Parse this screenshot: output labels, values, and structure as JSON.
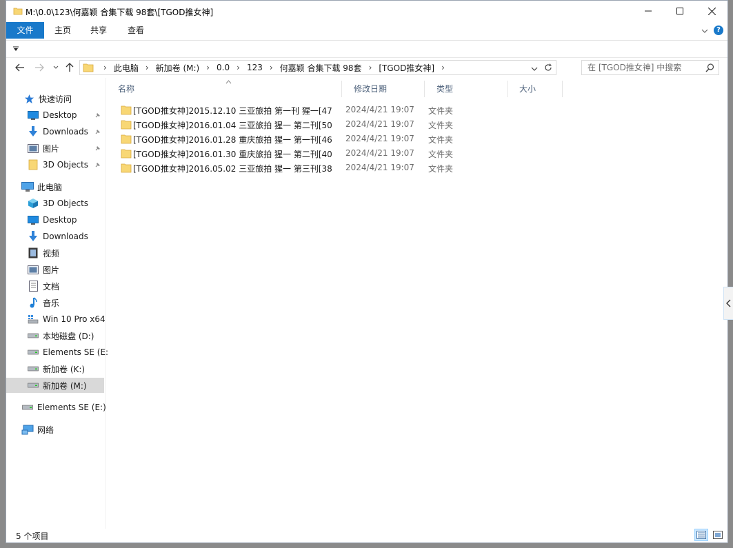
{
  "window": {
    "title": "M:\\0.0\\123\\何嘉颖 合集下载 98套\\[TGOD推女神]"
  },
  "ribbon": {
    "tabs": [
      "文件",
      "主页",
      "共享",
      "查看"
    ],
    "help_label": "?"
  },
  "address": {
    "crumbs": [
      "此电脑",
      "新加卷 (M:)",
      "0.0",
      "123",
      "何嘉颖 合集下载 98套",
      "[TGOD推女神]"
    ],
    "search_placeholder": "在 [TGOD推女神] 中搜索"
  },
  "navpane": {
    "quick_access": "快速访问",
    "quick_items": [
      {
        "label": "Desktop",
        "icon": "desktop-icon"
      },
      {
        "label": "Downloads",
        "icon": "downloads-icon"
      },
      {
        "label": "图片",
        "icon": "pictures-icon"
      },
      {
        "label": "3D Objects",
        "icon": "folder-icon"
      }
    ],
    "this_pc": "此电脑",
    "pc_items": [
      {
        "label": "3D Objects",
        "icon": "3d-objects-icon"
      },
      {
        "label": "Desktop",
        "icon": "desktop-icon"
      },
      {
        "label": "Downloads",
        "icon": "downloads-icon"
      },
      {
        "label": "视频",
        "icon": "videos-icon"
      },
      {
        "label": "图片",
        "icon": "pictures-icon"
      },
      {
        "label": "文档",
        "icon": "documents-icon"
      },
      {
        "label": "音乐",
        "icon": "music-icon"
      },
      {
        "label": "Win 10 Pro x64",
        "icon": "system-drive-icon"
      },
      {
        "label": "本地磁盘 (D:)",
        "icon": "drive-icon"
      },
      {
        "label": "Elements SE (E:",
        "icon": "drive-icon"
      },
      {
        "label": "新加卷 (K:)",
        "icon": "drive-icon"
      },
      {
        "label": "新加卷 (M:)",
        "icon": "drive-icon"
      }
    ],
    "elements": "Elements SE (E:)",
    "network": "网络"
  },
  "columns": {
    "name": "名称",
    "date": "修改日期",
    "type": "类型",
    "size": "大小"
  },
  "files": [
    {
      "name": "[TGOD推女神]2015.12.10 三亚旅拍 第一刊  猩一[47...",
      "date": "2024/4/21 19:07",
      "type": "文件夹"
    },
    {
      "name": "[TGOD推女神]2016.01.04 三亚旅拍 猩一 第二刊[50...",
      "date": "2024/4/21 19:07",
      "type": "文件夹"
    },
    {
      "name": "[TGOD推女神]2016.01.28 重庆旅拍 猩一 第一刊[46...",
      "date": "2024/4/21 19:07",
      "type": "文件夹"
    },
    {
      "name": "[TGOD推女神]2016.01.30 重庆旅拍 猩一 第二刊[40...",
      "date": "2024/4/21 19:07",
      "type": "文件夹"
    },
    {
      "name": "[TGOD推女神]2016.05.02 三亚旅拍 猩一 第三刊[38...",
      "date": "2024/4/21 19:07",
      "type": "文件夹"
    }
  ],
  "status": {
    "count": "5 个项目"
  },
  "colors": {
    "accent": "#1979ca",
    "folder": "#f8d775",
    "selected": "#d9d9d9"
  }
}
